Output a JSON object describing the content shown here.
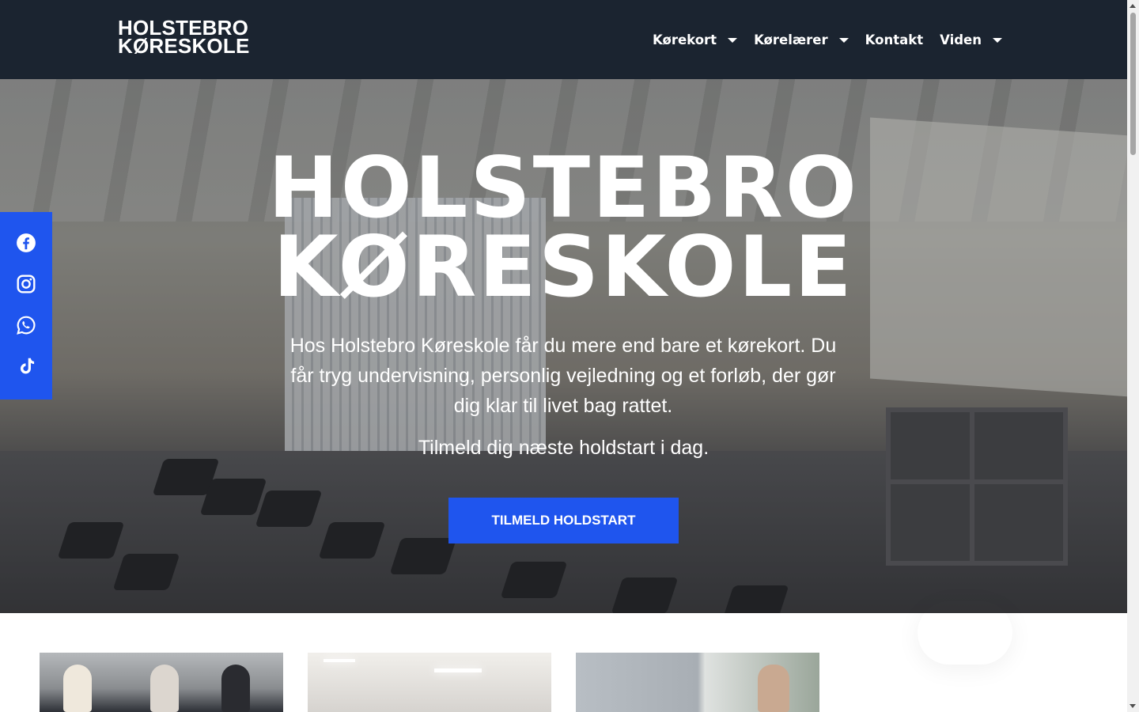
{
  "logo": {
    "line1": "HOLSTEBRO",
    "line2": "KØRESKOLE"
  },
  "nav": {
    "items": [
      {
        "label": "Kørekort",
        "dropdown": true
      },
      {
        "label": "Kørelærer",
        "dropdown": true
      },
      {
        "label": "Kontakt",
        "dropdown": false
      },
      {
        "label": "Viden",
        "dropdown": true
      }
    ]
  },
  "hero": {
    "title_line1": "HOLSTEBRO",
    "title_line2": "KØRESKOLE",
    "text": "Hos Holstebro Køreskole får du mere end bare et kørekort. Du får tryg undervisning, personlig vejledning og et forløb, der gør dig klar til livet bag rattet.",
    "subtext": "Tilmeld dig næste holdstart i dag.",
    "cta_label": "TILMELD HOLDSTART"
  },
  "social": [
    "facebook-icon",
    "instagram-icon",
    "whatsapp-icon",
    "tiktok-icon"
  ],
  "colors": {
    "header_bg": "#1b2430",
    "accent": "#1f55ee",
    "text_light": "#ffffff"
  }
}
